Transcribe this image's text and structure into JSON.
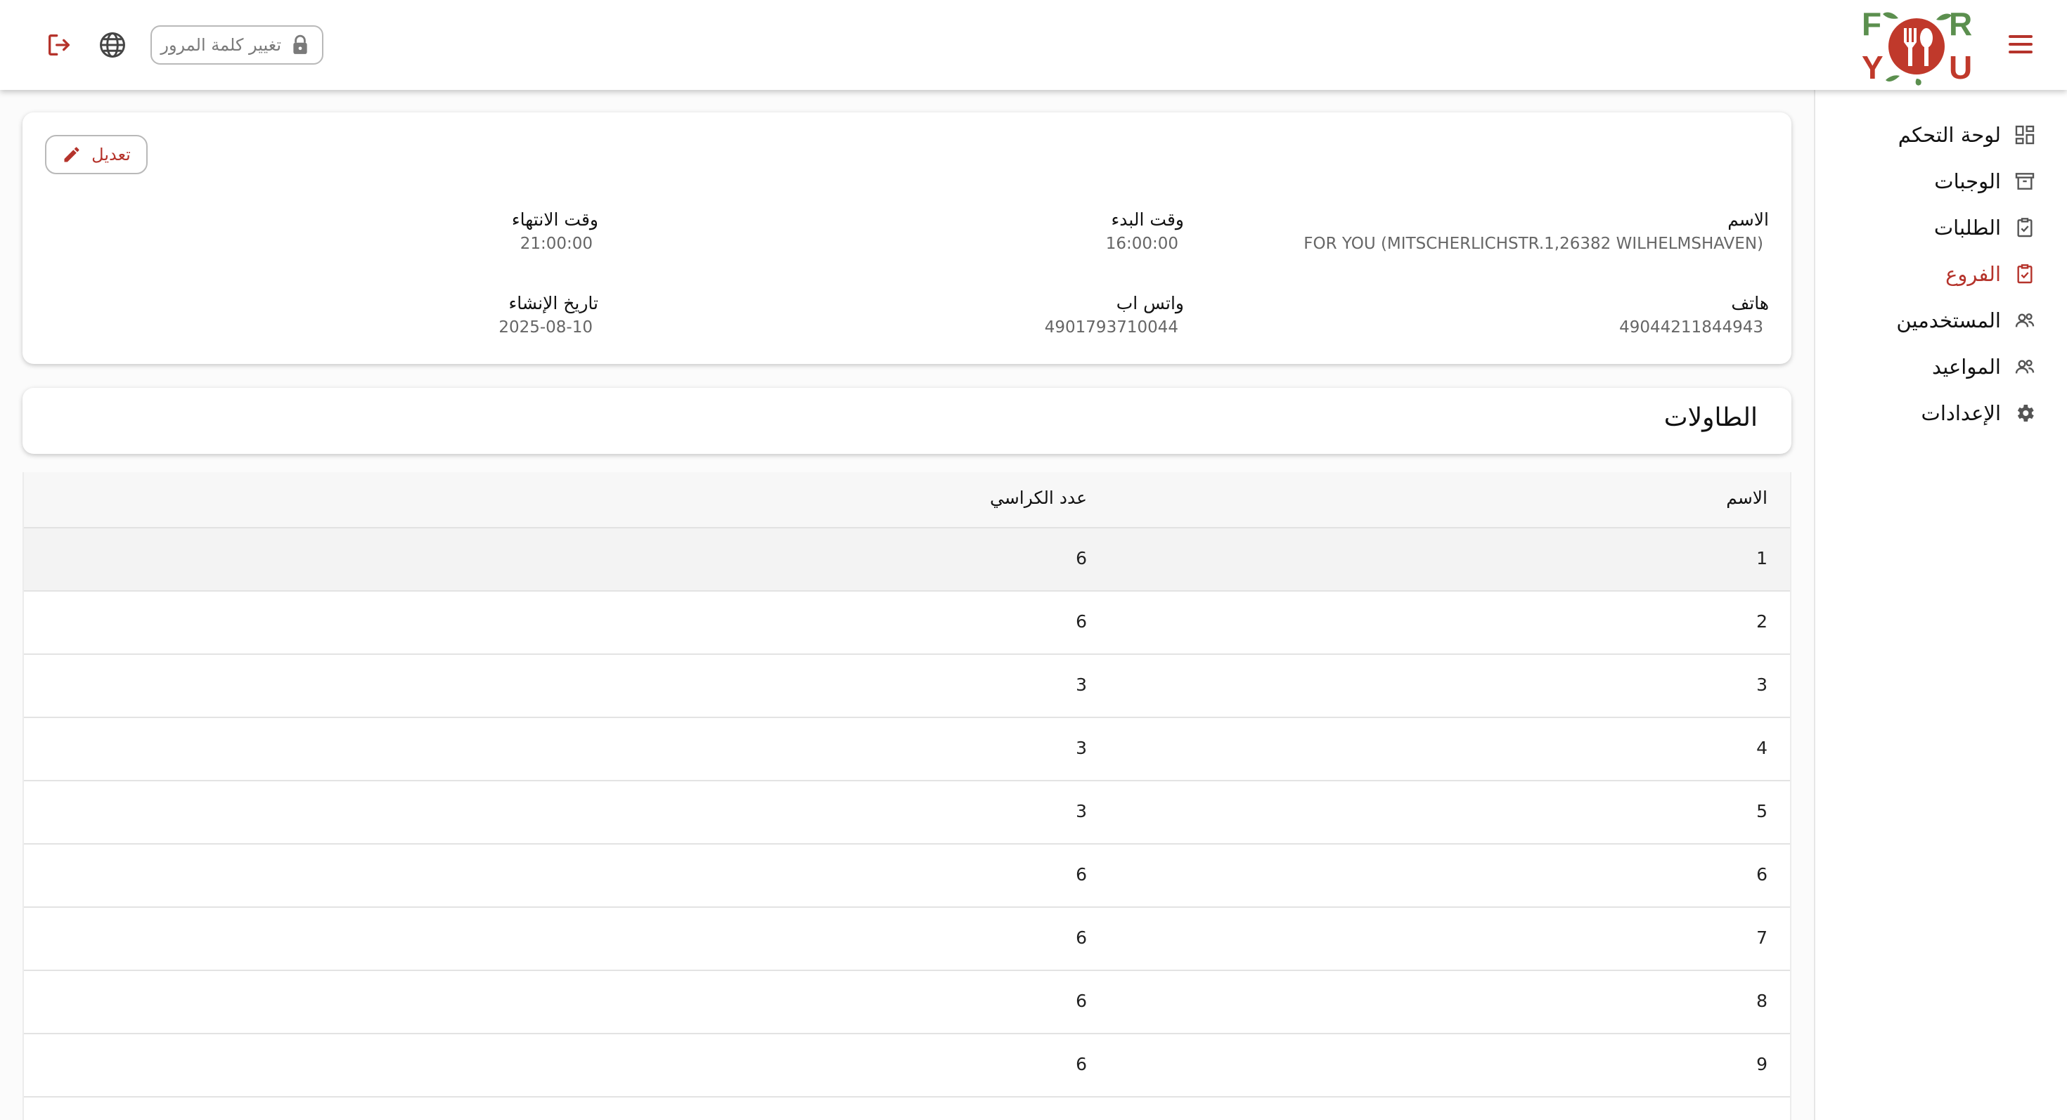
{
  "header": {
    "change_password_label": "تغيير كلمة المرور",
    "logo_text": "FOR YOU"
  },
  "sidebar": {
    "items": [
      {
        "label": "لوحة التحكم",
        "icon": "dashboard-icon"
      },
      {
        "label": "الوجبات",
        "icon": "archive-box-icon"
      },
      {
        "label": "الطلبات",
        "icon": "clipboard-check-icon"
      },
      {
        "label": "الفروع",
        "icon": "clipboard-check-icon"
      },
      {
        "label": "المستخدمين",
        "icon": "users-icon"
      },
      {
        "label": "المواعيد",
        "icon": "users-icon"
      },
      {
        "label": "الإعدادات",
        "icon": "gear-icon"
      }
    ],
    "active_item": "الفروع"
  },
  "branch": {
    "edit_label": "تعديل",
    "fields": {
      "name": {
        "label": "الاسم",
        "value": "FOR YOU (MITSCHERLICHSTR.1,26382 WILHELMSHAVEN)"
      },
      "start_time": {
        "label": "وقت البدء",
        "value": "16:00:00"
      },
      "end_time": {
        "label": "وقت الانتهاء",
        "value": "21:00:00"
      },
      "phone": {
        "label": "هاتف",
        "value": "49044211844943"
      },
      "whatsapp": {
        "label": "واتس اب",
        "value": "4901793710044"
      },
      "created_at": {
        "label": "تاريخ الإنشاء",
        "value": "2025-08-10"
      }
    }
  },
  "tables": {
    "title": "الطاولات",
    "columns": {
      "name": "الاسم",
      "chairs": "عدد الكراسي"
    },
    "rows": [
      {
        "name": "1",
        "chairs": "6"
      },
      {
        "name": "2",
        "chairs": "6"
      },
      {
        "name": "3",
        "chairs": "3"
      },
      {
        "name": "4",
        "chairs": "3"
      },
      {
        "name": "5",
        "chairs": "3"
      },
      {
        "name": "6",
        "chairs": "6"
      },
      {
        "name": "7",
        "chairs": "6"
      },
      {
        "name": "8",
        "chairs": "6"
      },
      {
        "name": "9",
        "chairs": "6"
      }
    ]
  },
  "colors": {
    "accent": "#b5332b",
    "logo_green": "#5b8f4e",
    "logo_red": "#c0392b"
  }
}
